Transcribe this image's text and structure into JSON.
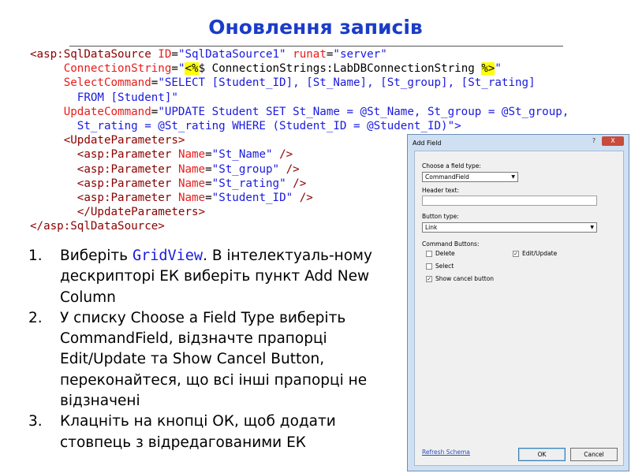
{
  "slide": {
    "title": "Оновлення записів"
  },
  "code": {
    "line1": {
      "tag": "<asp:SqlDataSource",
      "attr_id": "ID",
      "val_id": "\"SqlDataSource1\"",
      "attr_runat": "runat",
      "val_runat": "\"server\""
    },
    "line2": {
      "attr": "ConnectionString",
      "q_open": "\"",
      "hl_open": "<%",
      "text": "$ ConnectionStrings:LabDBConnectionString ",
      "hl_close": "%>",
      "q_close": "\""
    },
    "line3": {
      "attr": "SelectCommand",
      "val": "\"SELECT [Student_ID], [St_Name], [St_group], [St_rating]"
    },
    "line4": {
      "val": "FROM [Student]\""
    },
    "line5": {
      "attr": "UpdateCommand",
      "val": "\"UPDATE Student SET St_Name = @St_Name, St_group = @St_group,"
    },
    "line6": {
      "val": "St_rating = @St_rating WHERE (Student_ID = @Student_ID)\">"
    },
    "line7": {
      "tag": "<UpdateParameters>"
    },
    "params": [
      {
        "tag": "<asp:Parameter",
        "attr": "Name",
        "val": "\"St_Name\"",
        "end": "/>"
      },
      {
        "tag": "<asp:Parameter",
        "attr": "Name",
        "val": "\"St_group\"",
        "end": "/>"
      },
      {
        "tag": "<asp:Parameter",
        "attr": "Name",
        "val": "\"St_rating\"",
        "end": "/>"
      },
      {
        "tag": "<asp:Parameter",
        "attr": "Name",
        "val": "\"Student_ID\"",
        "end": "/>"
      }
    ],
    "line12": {
      "tag": "</UpdateParameters>"
    },
    "line13": {
      "tag": "</asp:SqlDataSource>"
    }
  },
  "steps": [
    {
      "num": "1.",
      "pre": "Виберіть ",
      "code": "GridView",
      "post": ". В інтелектуаль-ному дескрипторі ЕК виберіть пункт Add New Column"
    },
    {
      "num": "2.",
      "text": "У списку Choose a Field Type виберіть CommandField, відзначте прапорці Edit/Update та Show Cancel Button, переконайтеся, що всі інші прапорці не відзначені"
    },
    {
      "num": "3.",
      "text": "Клацніть на кнопці ОК, щоб додати стовпець з відредагованими ЕК"
    }
  ],
  "dialog": {
    "title": "Add Field",
    "window_buttons": {
      "help": "?",
      "close": "X"
    },
    "field_type_label": "Choose a field type:",
    "field_type_value": "CommandField",
    "header_text_label": "Header text:",
    "header_text_value": "",
    "button_type_label": "Button type:",
    "button_type_value": "Link",
    "command_buttons_label": "Command Buttons:",
    "checkboxes": [
      {
        "label": "Delete",
        "checked": false
      },
      {
        "label": "Edit/Update",
        "checked": true
      },
      {
        "label": "Select",
        "checked": false
      },
      {
        "label": "Show cancel button",
        "checked": true
      }
    ],
    "refresh_link": "Refresh Schema",
    "ok_label": "OK",
    "cancel_label": "Cancel"
  },
  "colors": {
    "title": "#1a3cc8",
    "code_tag": "#8b0000",
    "code_attr": "#e81c1c",
    "code_string": "#1a1adf",
    "highlight": "#ffff00",
    "dialog_frame": "#cfe0f3"
  }
}
